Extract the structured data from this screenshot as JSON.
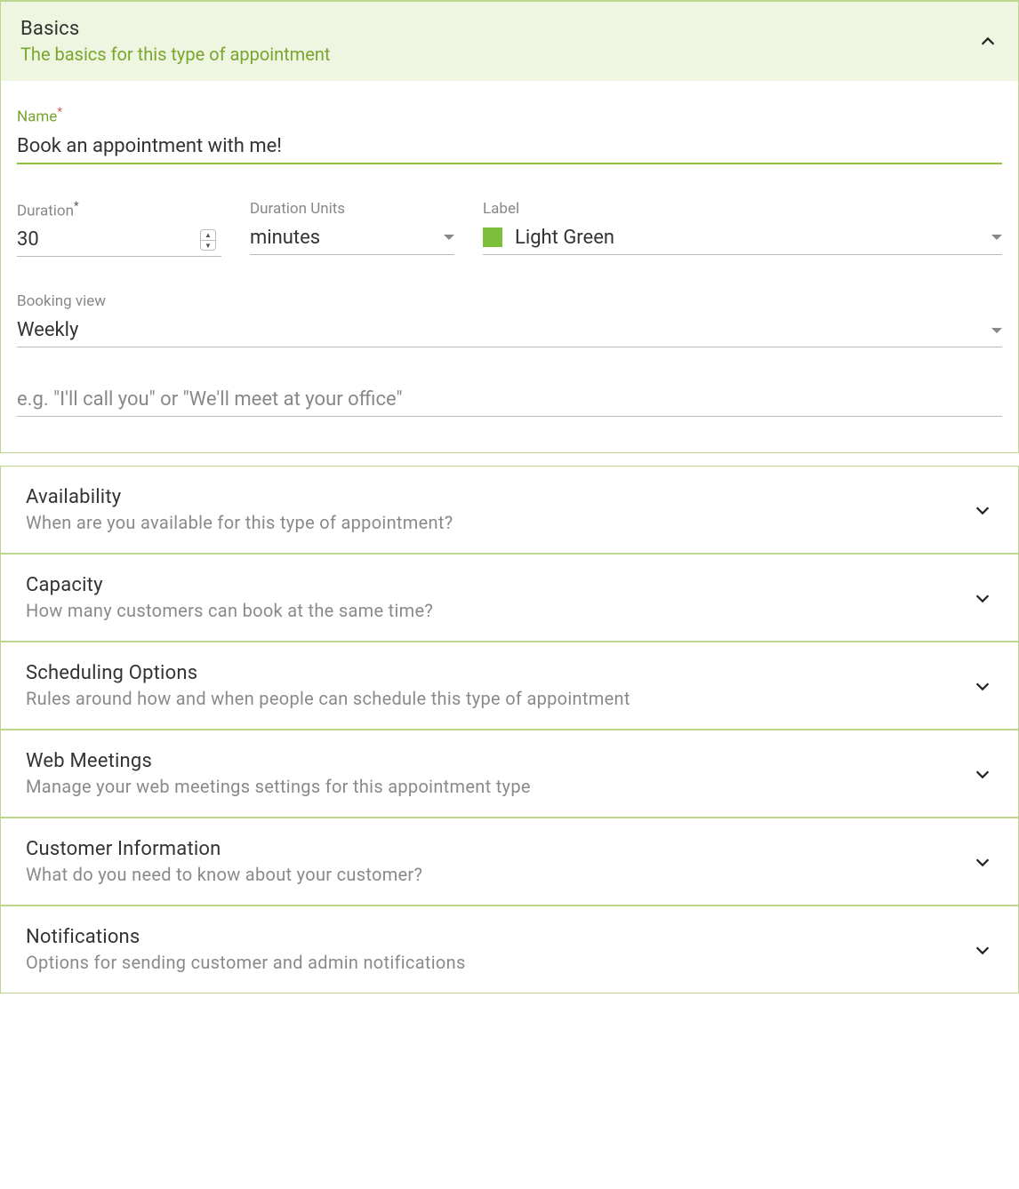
{
  "basics": {
    "title": "Basics",
    "subtitle": "The basics for this type of appointment",
    "name_label": "Name",
    "name_value": "Book an appointment with me!",
    "duration_label": "Duration",
    "duration_value": "30",
    "duration_units_label": "Duration Units",
    "duration_units_value": "minutes",
    "label_label": "Label",
    "label_value": "Light Green",
    "label_color": "#7bbf3a",
    "booking_view_label": "Booking view",
    "booking_view_value": "Weekly",
    "location_placeholder": "e.g. \"I'll call you\" or \"We'll meet at your office\""
  },
  "sections": [
    {
      "title": "Availability",
      "subtitle": "When are you available for this type of appointment?"
    },
    {
      "title": "Capacity",
      "subtitle": "How many customers can book at the same time?"
    },
    {
      "title": "Scheduling Options",
      "subtitle": "Rules around how and when people can schedule this type of appointment"
    },
    {
      "title": "Web Meetings",
      "subtitle": "Manage your web meetings settings for this appointment type"
    },
    {
      "title": "Customer Information",
      "subtitle": "What do you need to know about your customer?"
    },
    {
      "title": "Notifications",
      "subtitle": "Options for sending customer and admin notifications"
    }
  ]
}
